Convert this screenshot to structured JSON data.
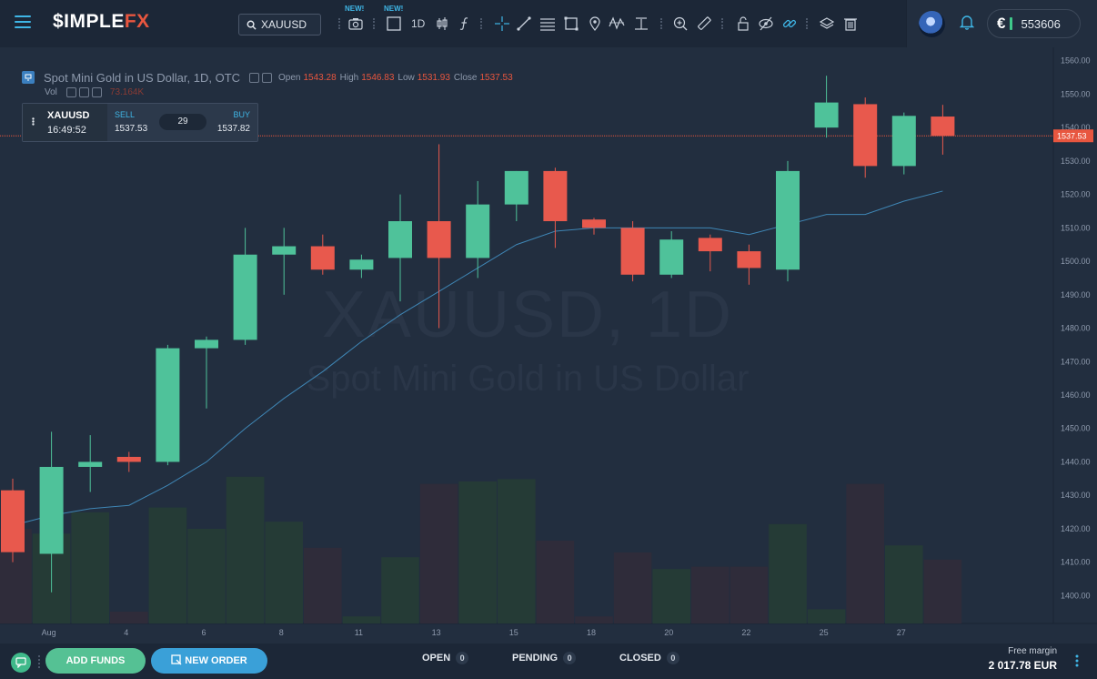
{
  "app": {
    "logo_main": "$IMPLE",
    "logo_accent": "FX"
  },
  "toolbar": {
    "symbol": "XAUUSD",
    "interval": "1D",
    "new_badge_1": "NEW!",
    "new_badge_2": "NEW!"
  },
  "account": {
    "currency": "€",
    "balance": "553606"
  },
  "legend": {
    "title": "Spot Mini Gold in US Dollar, 1D, OTC",
    "open_label": "Open",
    "open_value": "1543.28",
    "high_label": "High",
    "high_value": "1546.83",
    "low_label": "Low",
    "low_value": "1531.93",
    "close_label": "Close",
    "close_value": "1537.53",
    "vol_label": "Vol",
    "vol_value": "73.164K"
  },
  "trade_box": {
    "symbol": "XAUUSD",
    "time": "16:49:52",
    "sell_label": "SELL",
    "sell_value": "1537.53",
    "spread": "29",
    "buy_label": "BUY",
    "buy_value": "1537.82"
  },
  "watermark": {
    "symbol": "XAUUSD, 1D",
    "description": "Spot Mini Gold in US Dollar"
  },
  "colors": {
    "up": "#4fc29a",
    "down": "#e8594d",
    "ma": "#3f86b5",
    "price_line": "#e8563f",
    "background": "#222e3f"
  },
  "chart_data": {
    "type": "candlestick",
    "current_price": 1537.53,
    "current_price_label": "1537.53",
    "ylim": [
      1390,
      1562
    ],
    "y_ticks": [
      "1560.00",
      "1550.00",
      "1540.00",
      "1530.00",
      "1520.00",
      "1510.00",
      "1500.00",
      "1490.00",
      "1480.00",
      "1470.00",
      "1460.00",
      "1450.00",
      "1440.00",
      "1430.00",
      "1420.00",
      "1410.00",
      "1400.00"
    ],
    "y_tick_values": [
      1560,
      1550,
      1540,
      1530,
      1520,
      1510,
      1500,
      1490,
      1480,
      1470,
      1460,
      1450,
      1440,
      1430,
      1420,
      1410,
      1400
    ],
    "x_ticks": [
      "Aug",
      "4",
      "6",
      "8",
      "11",
      "13",
      "15",
      "18",
      "20",
      "22",
      "25",
      "27"
    ],
    "x_tick_index": [
      1,
      3,
      5,
      7,
      9,
      11,
      13,
      15,
      17,
      19,
      21,
      23
    ],
    "candles": [
      {
        "o": 1431.5,
        "h": 1435.0,
        "l": 1410.0,
        "c": 1413.0
      },
      {
        "o": 1412.5,
        "h": 1449.0,
        "l": 1401.0,
        "c": 1438.5
      },
      {
        "o": 1438.5,
        "h": 1448.0,
        "l": 1431.0,
        "c": 1440.0
      },
      {
        "o": 1441.5,
        "h": 1443.0,
        "l": 1437.0,
        "c": 1440.0
      },
      {
        "o": 1440.0,
        "h": 1475.0,
        "l": 1439.0,
        "c": 1474.0
      },
      {
        "o": 1474.0,
        "h": 1477.5,
        "l": 1456.0,
        "c": 1476.5
      },
      {
        "o": 1476.5,
        "h": 1510.0,
        "l": 1475.0,
        "c": 1502.0
      },
      {
        "o": 1502.0,
        "h": 1510.0,
        "l": 1490.0,
        "c": 1504.5
      },
      {
        "o": 1504.5,
        "h": 1508.0,
        "l": 1496.0,
        "c": 1497.5
      },
      {
        "o": 1497.5,
        "h": 1502.0,
        "l": 1495.0,
        "c": 1500.5
      },
      {
        "o": 1501.0,
        "h": 1520.0,
        "l": 1488.0,
        "c": 1512.0
      },
      {
        "o": 1512.0,
        "h": 1535.0,
        "l": 1480.0,
        "c": 1501.0
      },
      {
        "o": 1501.0,
        "h": 1524.0,
        "l": 1495.0,
        "c": 1517.0
      },
      {
        "o": 1517.0,
        "h": 1527.0,
        "l": 1512.0,
        "c": 1527.0
      },
      {
        "o": 1527.0,
        "h": 1528.0,
        "l": 1504.0,
        "c": 1512.0
      },
      {
        "o": 1512.5,
        "h": 1513.0,
        "l": 1508.0,
        "c": 1510.0
      },
      {
        "o": 1510.0,
        "h": 1512.0,
        "l": 1494.0,
        "c": 1496.0
      },
      {
        "o": 1496.0,
        "h": 1509.0,
        "l": 1495.0,
        "c": 1506.5
      },
      {
        "o": 1507.0,
        "h": 1508.0,
        "l": 1497.0,
        "c": 1503.0
      },
      {
        "o": 1503.0,
        "h": 1505.0,
        "l": 1493.0,
        "c": 1498.0
      },
      {
        "o": 1497.5,
        "h": 1530.0,
        "l": 1494.0,
        "c": 1527.0
      },
      {
        "o": 1540.0,
        "h": 1555.5,
        "l": 1537.0,
        "c": 1547.5
      },
      {
        "o": 1547.0,
        "h": 1549.0,
        "l": 1525.0,
        "c": 1528.5
      },
      {
        "o": 1528.5,
        "h": 1544.5,
        "l": 1526.0,
        "c": 1543.5
      },
      {
        "o": 1543.3,
        "h": 1546.8,
        "l": 1531.9,
        "c": 1537.5
      }
    ],
    "volumes": [
      0.4,
      0.38,
      0.47,
      0.05,
      0.49,
      0.4,
      0.62,
      0.43,
      0.32,
      0.03,
      0.28,
      0.59,
      0.6,
      0.61,
      0.35,
      0.03,
      0.3,
      0.23,
      0.24,
      0.24,
      0.42,
      0.06,
      0.59,
      0.33,
      0.27
    ],
    "ma": [
      1421,
      1424,
      1426,
      1427,
      1433,
      1440,
      1450,
      1459,
      1467,
      1476,
      1484,
      1491,
      1498,
      1505,
      1509,
      1510,
      1510,
      1510,
      1510,
      1508,
      1511,
      1514,
      1514,
      1518,
      1521
    ]
  },
  "bottom": {
    "add_funds": "ADD FUNDS",
    "new_order": "NEW ORDER",
    "open_label": "OPEN",
    "open_count": "0",
    "pending_label": "PENDING",
    "pending_count": "0",
    "closed_label": "CLOSED",
    "closed_count": "0",
    "free_margin_label": "Free margin",
    "free_margin_value": "2 017.78 EUR"
  }
}
